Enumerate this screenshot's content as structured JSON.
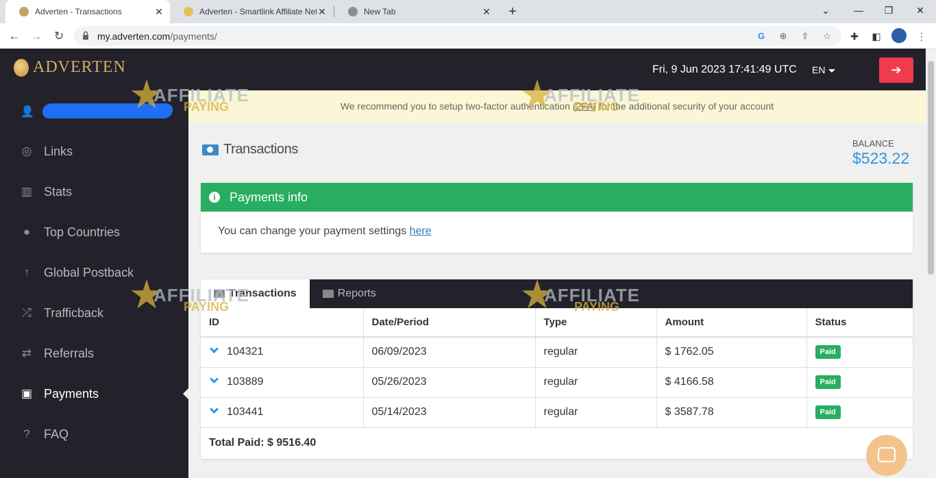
{
  "browser": {
    "tabs": [
      {
        "title": "Adverten - Transactions",
        "active": true
      },
      {
        "title": "Adverten - Smartlink Affiliate Net",
        "active": false
      },
      {
        "title": "New Tab",
        "active": false
      }
    ],
    "url_host": "my.adverten.com",
    "url_path": "/payments/"
  },
  "sidebar": {
    "logo_text": "ADVERTEN",
    "items": [
      {
        "label": "Links",
        "icon": "link-icon"
      },
      {
        "label": "Stats",
        "icon": "bar-chart-icon"
      },
      {
        "label": "Top Countries",
        "icon": "globe-icon"
      },
      {
        "label": "Global Postback",
        "icon": "arrow-up-icon"
      },
      {
        "label": "Trafficback",
        "icon": "shuffle-icon"
      },
      {
        "label": "Referrals",
        "icon": "exchange-icon"
      },
      {
        "label": "Payments",
        "icon": "money-icon",
        "active": true
      },
      {
        "label": "FAQ",
        "icon": "question-icon"
      }
    ]
  },
  "header": {
    "datetime": "Fri, 9 Jun 2023 17:41:49 UTC",
    "lang": "EN"
  },
  "banner": {
    "prefix": "We recommend you to setup two-factor authentication",
    "link": "(2FA)",
    "suffix": "for the additional security of your account"
  },
  "page": {
    "title": "Transactions",
    "balance_label": "BALANCE",
    "balance_value": "$523.22"
  },
  "payments_info": {
    "heading": "Payments info",
    "text": "You can change your payment settings",
    "link": "here"
  },
  "transactions": {
    "tabs": [
      "Transactions",
      "Reports"
    ],
    "columns": [
      "ID",
      "Date/Period",
      "Type",
      "Amount",
      "Status"
    ],
    "rows": [
      {
        "id": "104321",
        "date": "06/09/2023",
        "type": "regular",
        "amount": "$ 1762.05",
        "status": "Paid"
      },
      {
        "id": "103889",
        "date": "05/26/2023",
        "type": "regular",
        "amount": "$ 4166.58",
        "status": "Paid"
      },
      {
        "id": "103441",
        "date": "05/14/2023",
        "type": "regular",
        "amount": "$ 3587.78",
        "status": "Paid"
      }
    ],
    "total": "Total Paid: $ 9516.40"
  },
  "watermark": {
    "line1": "AFFILIATE",
    "line2": "PAYING"
  },
  "colors": {
    "green": "#27ae60",
    "accent_blue": "#2f95dd",
    "logout_red": "#ee3c4e",
    "sidebar_bg": "#23222b"
  }
}
